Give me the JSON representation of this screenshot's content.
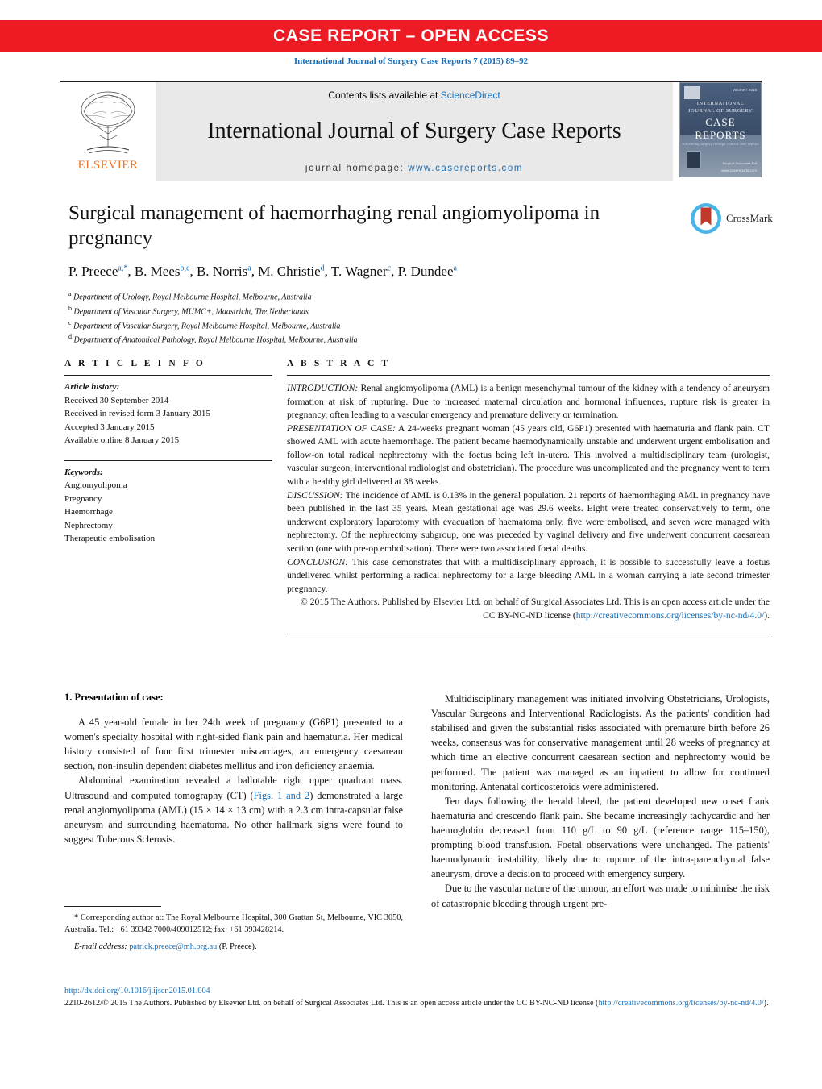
{
  "banner": {
    "text": "CASE REPORT – OPEN ACCESS"
  },
  "citation": "International Journal of Surgery Case Reports 7 (2015) 89–92",
  "masthead": {
    "publisher": "ELSEVIER",
    "contents_prefix": "Contents lists available at ",
    "contents_link": "ScienceDirect",
    "journal_name": "International Journal of Surgery Case Reports",
    "homepage_label": "journal homepage: ",
    "homepage_url": "www.casereports.com",
    "cover": {
      "line1": "INTERNATIONAL",
      "line2": "JOURNAL OF SURGERY",
      "line3": "CASE",
      "line4": "REPORTS",
      "tagline": "Advancing surgery through clinical case reports",
      "volume": "Volume 7 2015",
      "foot": "Surgical Associates Ltd",
      "foot2": "www.casereports.com"
    }
  },
  "article": {
    "title": "Surgical management of haemorrhaging renal angiomyolipoma in pregnancy",
    "crossmark_label": "CrossMark",
    "authors": [
      {
        "name": "P. Preece",
        "sup": "a,*"
      },
      {
        "name": "B. Mees",
        "sup": "b,c"
      },
      {
        "name": "B. Norris",
        "sup": "a"
      },
      {
        "name": "M. Christie",
        "sup": "d"
      },
      {
        "name": "T. Wagner",
        "sup": "c"
      },
      {
        "name": "P. Dundee",
        "sup": "a"
      }
    ],
    "affiliations": [
      {
        "mark": "a",
        "text": "Department of Urology, Royal Melbourne Hospital, Melbourne, Australia"
      },
      {
        "mark": "b",
        "text": "Department of Vascular Surgery, MUMC+, Maastricht, The Netherlands"
      },
      {
        "mark": "c",
        "text": "Department of Vascular Surgery, Royal Melbourne Hospital, Melbourne, Australia"
      },
      {
        "mark": "d",
        "text": "Department of Anatomical Pathology, Royal Melbourne Hospital, Melbourne, Australia"
      }
    ]
  },
  "article_info": {
    "heading": "A R T I C L E   I N F O",
    "history_label": "Article history:",
    "history": [
      "Received 30 September 2014",
      "Received in revised form 3 January 2015",
      "Accepted 3 January 2015",
      "Available online 8 January 2015"
    ],
    "keywords_label": "Keywords:",
    "keywords": [
      "Angiomyolipoma",
      "Pregnancy",
      "Haemorrhage",
      "Nephrectomy",
      "Therapeutic embolisation"
    ]
  },
  "abstract": {
    "heading": "A B S T R A C T",
    "sections": [
      {
        "label": "INTRODUCTION:",
        "text": " Renal angiomyolipoma (AML) is a benign mesenchymal tumour of the kidney with a tendency of aneurysm formation at risk of rupturing. Due to increased maternal circulation and hormonal influences, rupture risk is greater in pregnancy, often leading to a vascular emergency and premature delivery or termination."
      },
      {
        "label": "PRESENTATION OF CASE:",
        "text": " A 24-weeks pregnant woman (45 years old, G6P1) presented with haematuria and flank pain. CT showed AML with acute haemorrhage. The patient became haemodynamically unstable and underwent urgent embolisation and follow-on total radical nephrectomy with the foetus being left in-utero. This involved a multidisciplinary team (urologist, vascular surgeon, interventional radiologist and obstetrician). The procedure was uncomplicated and the pregnancy went to term with a healthy girl delivered at 38 weeks."
      },
      {
        "label": "DISCUSSION:",
        "text": " The incidence of AML is 0.13% in the general population. 21 reports of haemorrhaging AML in pregnancy have been published in the last 35 years. Mean gestational age was 29.6 weeks. Eight were treated conservatively to term, one underwent exploratory laparotomy with evacuation of haematoma only, five were embolised, and seven were managed with nephrectomy. Of the nephrectomy subgroup, one was preceded by vaginal delivery and five underwent concurrent caesarean section (one with pre-op embolisation). There were two associated foetal deaths."
      },
      {
        "label": "CONCLUSION:",
        "text": " This case demonstrates that with a multidisciplinary approach, it is possible to successfully leave a foetus undelivered whilst performing a radical nephrectomy for a large bleeding AML in a woman carrying a late second trimester pregnancy."
      }
    ],
    "copyright_pre": "© 2015 The Authors. Published by Elsevier Ltd. on behalf of Surgical Associates Ltd. This is an open access article under the CC BY-NC-ND license (",
    "copyright_link": "http://creativecommons.org/licenses/by-nc-nd/4.0/",
    "copyright_post": ")."
  },
  "body": {
    "section_heading": "1.  Presentation of case:",
    "left_paragraphs": [
      "A 45 year-old female in her 24th week of pregnancy (G6P1) presented to a women's specialty hospital with right-sided flank pain and haematuria. Her medical history consisted of four first trimester miscarriages, an emergency caesarean section, non-insulin dependent diabetes mellitus and iron deficiency anaemia."
    ],
    "left_paragraph_2_pre": "Abdominal examination revealed a ballotable right upper quadrant mass. Ultrasound and computed tomography (CT) (",
    "left_paragraph_2_link": "Figs. 1 and 2",
    "left_paragraph_2_post": ") demonstrated a large renal angiomyolipoma (AML) (15 × 14 × 13 cm) with a 2.3 cm intra-capsular false aneurysm and surrounding haematoma. No other hallmark signs were found to suggest Tuberous Sclerosis.",
    "right_paragraphs": [
      "Multidisciplinary management was initiated involving Obstetricians, Urologists, Vascular Surgeons and Interventional Radiologists. As the patients' condition had stabilised and given the substantial risks associated with premature birth before 26 weeks, consensus was for conservative management until 28 weeks of pregnancy at which time an elective concurrent caesarean section and nephrectomy would be performed. The patient was managed as an inpatient to allow for continued monitoring. Antenatal corticosteroids were administered.",
      "Ten days following the herald bleed, the patient developed new onset frank haematuria and crescendo flank pain. She became increasingly tachycardic and her haemoglobin decreased from 110 g/L to 90 g/L (reference range 115–150), prompting blood transfusion. Foetal observations were unchanged. The patients' haemodynamic instability, likely due to rupture of the intra-parenchymal false aneurysm, drove a decision to proceed with emergency surgery.",
      "Due to the vascular nature of the tumour, an effort was made to minimise the risk of catastrophic bleeding through urgent pre-"
    ]
  },
  "footnote": {
    "corresponding": "* Corresponding author at: The Royal Melbourne Hospital, 300 Grattan St, Melbourne, VIC 3050, Australia. Tel.: +61 39342 7000/409012512; fax: +61 393428214.",
    "email_label": "E-mail address:",
    "email": "patrick.preece@mh.org.au",
    "email_suffix": "(P. Preece)."
  },
  "bottom": {
    "doi": "http://dx.doi.org/10.1016/j.ijscr.2015.01.004",
    "issn_line_pre": "2210-2612/© 2015 The Authors. Published by Elsevier Ltd. on behalf of Surgical Associates Ltd. This is an open access article under the CC BY-NC-ND license (",
    "issn_link": "http://creativecommons.org/licenses/by-nc-nd/4.0/",
    "issn_line_post": ")."
  },
  "colors": {
    "banner_red": "#ed1c24",
    "link_blue": "#1a6eb5",
    "elsevier_orange": "#ef7622",
    "crossmark_blue": "#4ab4e6",
    "crossmark_red": "#c0392b"
  }
}
